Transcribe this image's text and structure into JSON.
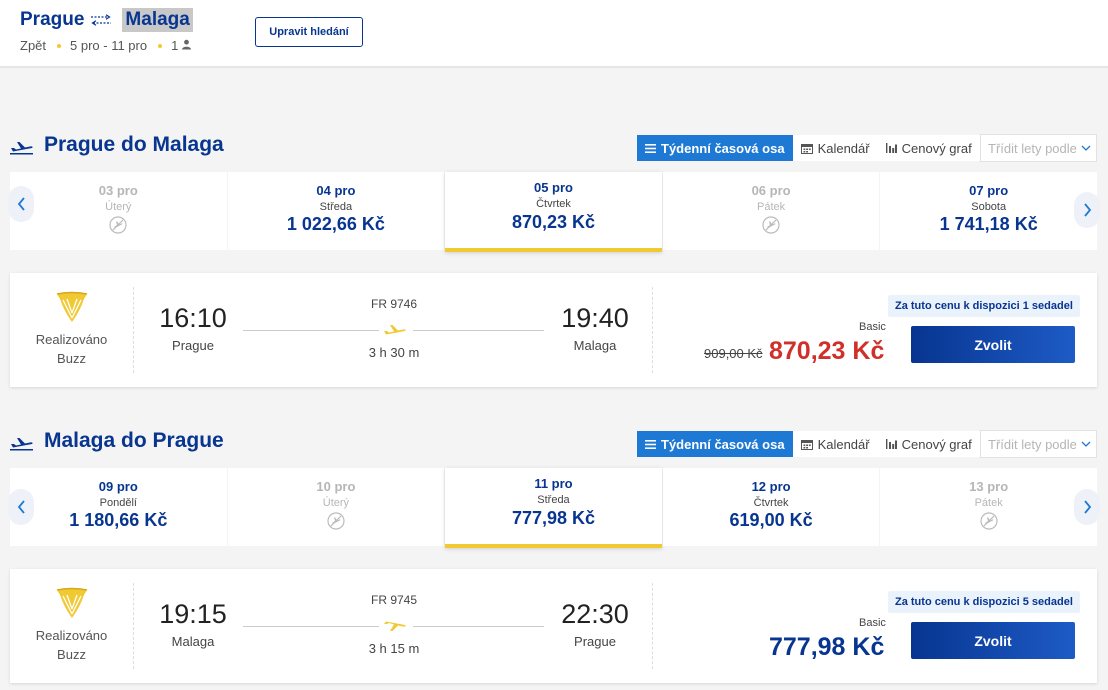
{
  "header": {
    "origin": "Prague",
    "destination": "Malaga",
    "back": "Zpět",
    "dates": "5 pro - 11 pro",
    "passengers": "1",
    "edit_button": "Upravit hledání"
  },
  "view_buttons": {
    "weekly": "Týdenní časová osa",
    "calendar": "Kalendář",
    "price_graph": "Cenový graf",
    "sort": "Třídit lety podle"
  },
  "outbound": {
    "title": "Prague do Malaga",
    "days": [
      {
        "date": "03 pro",
        "dow": "Úterý",
        "price": ""
      },
      {
        "date": "04 pro",
        "dow": "Středa",
        "price": "1 022,66 Kč"
      },
      {
        "date": "05 pro",
        "dow": "Čtvrtek",
        "price": "870,23 Kč"
      },
      {
        "date": "06 pro",
        "dow": "Pátek",
        "price": ""
      },
      {
        "date": "07 pro",
        "dow": "Sobota",
        "price": "1 741,18 Kč"
      }
    ],
    "flight": {
      "operator_line1": "Realizováno",
      "operator_line2": "Buzz",
      "dep_time": "16:10",
      "dep_city": "Prague",
      "flight_no": "FR 9746",
      "duration": "3 h 30 m",
      "arr_time": "19:40",
      "arr_city": "Malaga",
      "seats_note": "Za tuto cenu k dispozici 1 sedadel",
      "fare": "Basic",
      "old_price": "909,00 Kč",
      "price": "870,23 Kč",
      "select": "Zvolit"
    }
  },
  "inbound": {
    "title": "Malaga do Prague",
    "days": [
      {
        "date": "09 pro",
        "dow": "Pondělí",
        "price": "1 180,66 Kč"
      },
      {
        "date": "10 pro",
        "dow": "Úterý",
        "price": ""
      },
      {
        "date": "11 pro",
        "dow": "Středa",
        "price": "777,98 Kč"
      },
      {
        "date": "12 pro",
        "dow": "Čtvrtek",
        "price": "619,00 Kč"
      },
      {
        "date": "13 pro",
        "dow": "Pátek",
        "price": ""
      }
    ],
    "flight": {
      "operator_line1": "Realizováno",
      "operator_line2": "Buzz",
      "dep_time": "19:15",
      "dep_city": "Malaga",
      "flight_no": "FR 9745",
      "duration": "3 h 15 m",
      "arr_time": "22:30",
      "arr_city": "Prague",
      "seats_note": "Za tuto cenu k dispozici 5 sedadel",
      "fare": "Basic",
      "price": "777,98 Kč",
      "select": "Zvolit"
    }
  },
  "colors": {
    "brand_blue": "#073590",
    "active_tab": "#1e79d4",
    "accent_yellow": "#f1c933",
    "sale_red": "#d0302a"
  }
}
